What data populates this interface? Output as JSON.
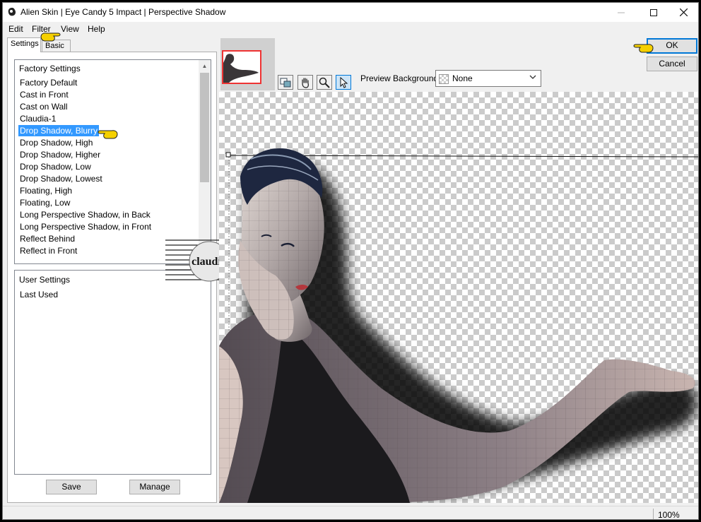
{
  "window": {
    "title": "Alien Skin | Eye Candy 5 Impact | Perspective Shadow"
  },
  "menu": [
    "Edit",
    "Filter",
    "View",
    "Help"
  ],
  "tabs": {
    "settings": "Settings",
    "basic": "Basic"
  },
  "factory_settings": {
    "header": "Factory Settings",
    "items": [
      "Factory Default",
      "Cast in Front",
      "Cast on Wall",
      "Claudia-1",
      "Drop Shadow, Blurry",
      "Drop Shadow, High",
      "Drop Shadow, Higher",
      "Drop Shadow, Low",
      "Drop Shadow, Lowest",
      "Floating, High",
      "Floating, Low",
      "Long Perspective Shadow, in Back",
      "Long Perspective Shadow, in Front",
      "Reflect Behind",
      "Reflect in Front"
    ],
    "selected": "Drop Shadow, Blurry"
  },
  "user_settings": {
    "header": "User Settings",
    "items": [
      "Last Used"
    ]
  },
  "buttons": {
    "save": "Save",
    "manage": "Manage",
    "ok": "OK",
    "cancel": "Cancel"
  },
  "preview_background": {
    "label": "Preview Background:",
    "value": "None"
  },
  "watermark": "claudia",
  "status": {
    "zoom": "100%"
  },
  "colors": {
    "selection": "#3399ff",
    "default_button_border": "#0078d7",
    "thumbnail_border": "#e33333",
    "pointer_hand": "#f5d000"
  },
  "icons": [
    "app-logo-icon",
    "minimize-icon",
    "maximize-icon",
    "close-icon",
    "preview-compare-icon",
    "hand-pan-icon",
    "zoom-magnifier-icon",
    "arrow-select-icon",
    "chevron-down-icon",
    "pointing-hand-icon"
  ]
}
